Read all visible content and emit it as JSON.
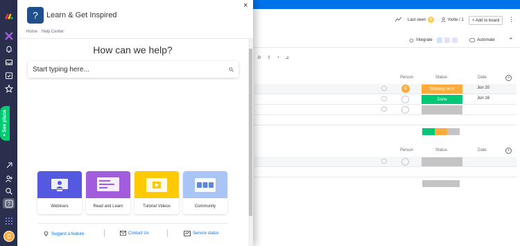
{
  "help_panel": {
    "title": "Learn & Get Inspired",
    "badge_glyph": "?",
    "close_glyph": "×",
    "breadcrumbs": [
      "Home",
      "Help Center"
    ],
    "heading": "How can we help?",
    "search_placeholder": "Start typing here...",
    "cards": [
      {
        "label": "Webinars",
        "color": "#5559df"
      },
      {
        "label": "Read and Learn",
        "color": "#a25ddc"
      },
      {
        "label": "Tutorial Videos",
        "color": "#ffcb00"
      },
      {
        "label": "Community",
        "color": "#a8c5f5"
      }
    ],
    "footer": {
      "suggest": "Suggest a feature",
      "contact": "Contact Us",
      "status": "Service status"
    }
  },
  "rail": {
    "see_plans": "+ See plans",
    "avatar_initial": "C"
  },
  "board": {
    "last_seen": "Last seen",
    "last_seen_initial": "C",
    "invite": "Invite / 1",
    "add_to_board": "+ Add to board",
    "integrate": "Integrate",
    "automate": "Automate",
    "columns": {
      "person": "Person",
      "status": "Status",
      "date": "Date"
    },
    "group1_rows": [
      {
        "status": "Working on it",
        "status_color": "#fdab3d",
        "date": "Jun 20",
        "person": "C"
      },
      {
        "status": "Done",
        "status_color": "#00c875",
        "date": "Jun 16",
        "person": ""
      },
      {
        "status": "",
        "status_color": "#c4c4c4",
        "date": "",
        "person": ""
      }
    ],
    "group2_rows": [
      {
        "status": "",
        "status_color": "#c4c4c4",
        "date": "",
        "person": ""
      }
    ],
    "colors": {
      "topbar": "#0073ea",
      "rail": "#292f4c",
      "working": "#fdab3d",
      "done": "#00c875",
      "empty": "#c4c4c4"
    }
  }
}
